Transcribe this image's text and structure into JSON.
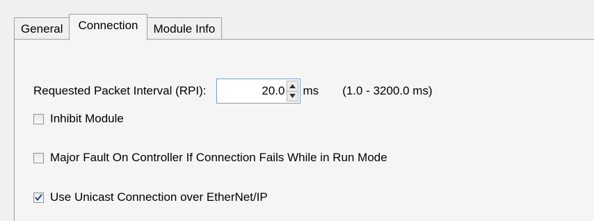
{
  "tabs": [
    {
      "label": "General",
      "active": false
    },
    {
      "label": "Connection",
      "active": true
    },
    {
      "label": "Module Info",
      "active": false
    }
  ],
  "rpi": {
    "label": "Requested Packet Interval (RPI):",
    "value": "20.0",
    "unit": "ms",
    "range": "(1.0 - 3200.0 ms)"
  },
  "options": [
    {
      "label": "Inhibit Module",
      "checked": false
    },
    {
      "label": "Major Fault On Controller If Connection Fails While in Run Mode",
      "checked": false
    },
    {
      "label": "Use Unicast Connection over EtherNet/IP",
      "checked": true
    }
  ],
  "colors": {
    "input_border": "#7a9ccc",
    "checkmark": "#1a3fa0"
  },
  "icons": {
    "spin_up": "triangle-up-icon",
    "spin_down": "triangle-down-icon",
    "checked": "checkmark-icon"
  }
}
